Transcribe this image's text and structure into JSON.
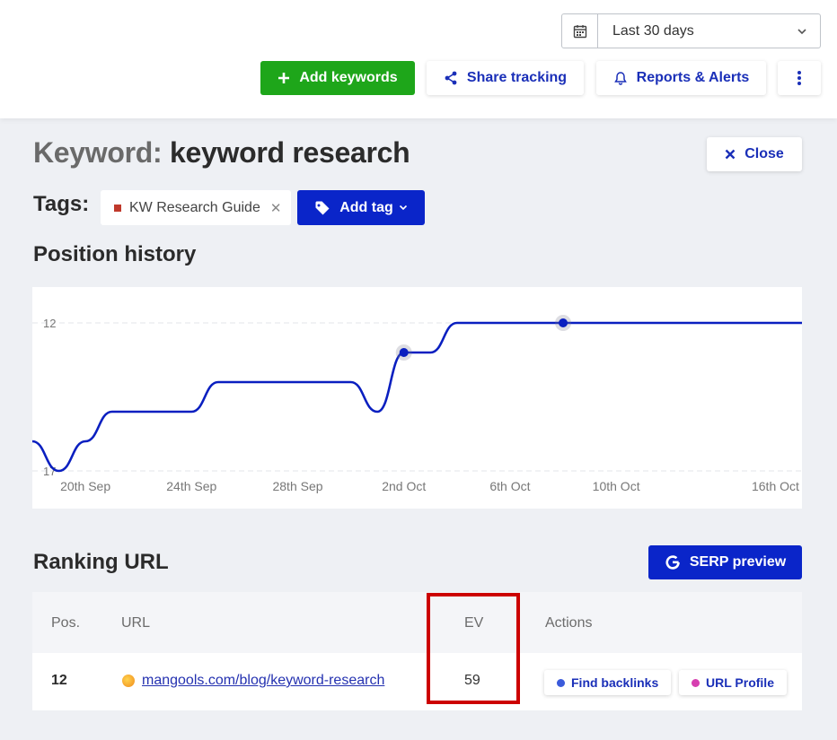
{
  "header": {
    "date_range": "Last 30 days",
    "add_keywords": "Add keywords",
    "share_tracking": "Share tracking",
    "reports_alerts": "Reports & Alerts"
  },
  "keyword": {
    "label": "Keyword:",
    "value": "keyword research",
    "close": "Close"
  },
  "tags": {
    "label": "Tags:",
    "items": [
      {
        "name": "KW Research Guide",
        "color": "#c0392b"
      }
    ],
    "add_tag": "Add tag"
  },
  "position_history": {
    "title": "Position history"
  },
  "chart_data": {
    "type": "line",
    "title": "Position history",
    "x_ticks": [
      "20th Sep",
      "24th Sep",
      "28th Sep",
      "2nd Oct",
      "6th Oct",
      "10th Oct",
      "16th Oct"
    ],
    "y_ticks": [
      "12",
      "17"
    ],
    "y_inverted": true,
    "ylim": [
      12,
      17
    ],
    "grid": "horizontal dashed",
    "series": [
      {
        "color": "#0a1fc0",
        "x": [
          "18th Sep",
          "19th Sep",
          "20th Sep",
          "21st Sep",
          "22nd Sep",
          "23rd Sep",
          "24th Sep",
          "25th Sep",
          "26th Sep",
          "27th Sep",
          "28th Sep",
          "29th Sep",
          "30th Sep",
          "1st Oct",
          "2nd Oct",
          "3rd Oct",
          "4th Oct",
          "5th Oct",
          "6th Oct",
          "7th Oct",
          "8th Oct",
          "9th Oct",
          "10th Oct",
          "11th Oct",
          "12th Oct",
          "13th Oct",
          "14th Oct",
          "15th Oct",
          "16th Oct",
          "17th Oct"
        ],
        "values": [
          16,
          17,
          16,
          15,
          15,
          15,
          15,
          14,
          14,
          14,
          14,
          14,
          14,
          15,
          13,
          13,
          12,
          12,
          12,
          12,
          12,
          12,
          12,
          12,
          12,
          12,
          12,
          12,
          12,
          12
        ],
        "markers": [
          {
            "x": "2nd Oct",
            "value": 13
          },
          {
            "x": "8th Oct",
            "value": 12
          }
        ]
      }
    ]
  },
  "ranking": {
    "title": "Ranking URL",
    "serp_preview": "SERP preview",
    "columns": [
      "Pos.",
      "URL",
      "EV",
      "Actions"
    ],
    "rows": [
      {
        "pos": "12",
        "url": "mangools.com/blog/keyword-research",
        "ev": "59"
      }
    ],
    "find_backlinks": "Find backlinks",
    "url_profile": "URL Profile",
    "find_backlinks_color": "#3b5bdb",
    "url_profile_color": "#d63fb0"
  }
}
